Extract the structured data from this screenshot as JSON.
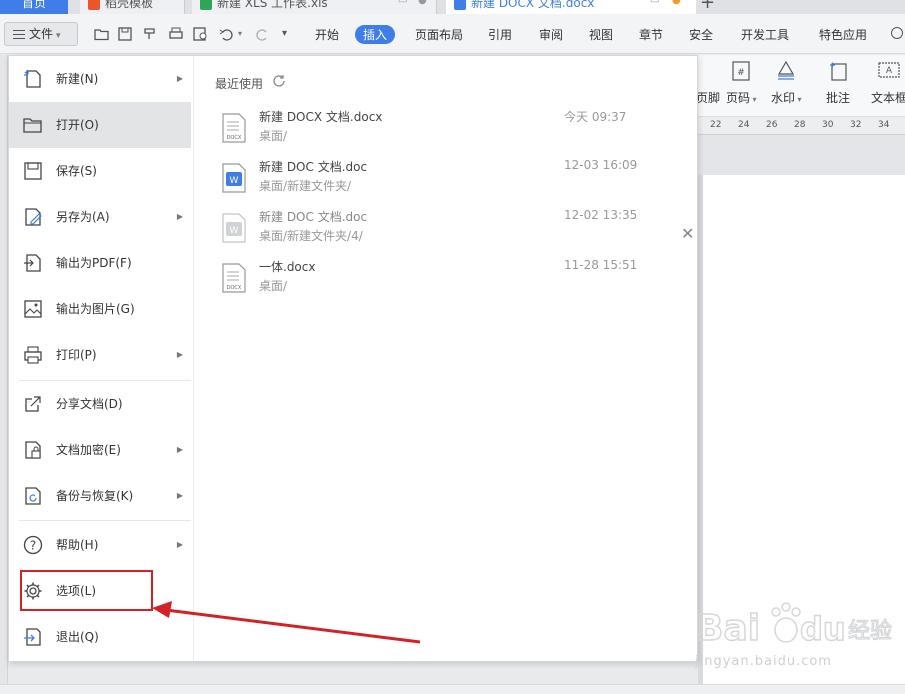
{
  "tabs": {
    "home": "首页",
    "template": "稻壳模板",
    "xls": "新建 XLS 工作表.xls",
    "docx": "新建 DOCX 文档.docx",
    "add": "+"
  },
  "menubar": {
    "file_label": "文件",
    "tabs": [
      "开始",
      "插入",
      "页面布局",
      "引用",
      "审阅",
      "视图",
      "章节",
      "安全",
      "开发工具",
      "特色应用"
    ],
    "active_tab": "插入"
  },
  "ribbon": {
    "tools": [
      "页脚",
      "页码",
      "水印",
      "批注",
      "文本框"
    ]
  },
  "ruler": {
    "ticks": [
      "22",
      "24",
      "26",
      "28",
      "30",
      "32",
      "34"
    ]
  },
  "file_menu": {
    "items": [
      {
        "label": "新建(N)",
        "icon": "new-doc-icon",
        "submenu": true
      },
      {
        "label": "打开(O)",
        "icon": "folder-open-icon",
        "submenu": false
      },
      {
        "label": "保存(S)",
        "icon": "save-icon",
        "submenu": false
      },
      {
        "label": "另存为(A)",
        "icon": "save-as-icon",
        "submenu": true
      },
      {
        "label": "输出为PDF(F)",
        "icon": "export-pdf-icon",
        "submenu": false
      },
      {
        "label": "输出为图片(G)",
        "icon": "export-image-icon",
        "submenu": false
      },
      {
        "label": "打印(P)",
        "icon": "print-icon",
        "submenu": true
      },
      {
        "label": "分享文档(D)",
        "icon": "share-icon",
        "submenu": false
      },
      {
        "label": "文档加密(E)",
        "icon": "encrypt-icon",
        "submenu": true
      },
      {
        "label": "备份与恢复(K)",
        "icon": "backup-icon",
        "submenu": true
      },
      {
        "label": "帮助(H)",
        "icon": "help-icon",
        "submenu": true
      },
      {
        "label": "选项(L)",
        "icon": "gear-icon",
        "submenu": false
      },
      {
        "label": "退出(Q)",
        "icon": "exit-icon",
        "submenu": false
      }
    ],
    "active_item": "打开(O)"
  },
  "recent": {
    "title": "最近使用",
    "files": [
      {
        "name": "新建 DOCX 文档.docx",
        "path": "桌面/",
        "time": "今天 09:37",
        "type": "docx"
      },
      {
        "name": "新建 DOC 文档.doc",
        "path": "桌面/新建文件夹/",
        "time": "12-03 16:09",
        "type": "doc"
      },
      {
        "name": "新建 DOC 文档.doc",
        "path": "桌面/新建文件夹/4/",
        "time": "12-02 13:35",
        "type": "doc-dim"
      },
      {
        "name": "一体.docx",
        "path": "桌面/",
        "time": "11-28 15:51",
        "type": "docx"
      }
    ]
  },
  "watermark": {
    "brand": "Bai",
    "brand2": "du",
    "site": "jingyan.baidu.com",
    "cn": "经验"
  },
  "colors": {
    "accent": "#3f7ee8",
    "annotation": "#d42027"
  }
}
